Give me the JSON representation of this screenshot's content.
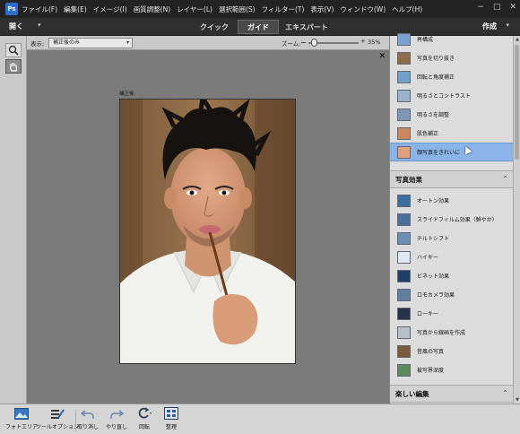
{
  "menubar": {
    "items": [
      "ファイル(F)",
      "編集(E)",
      "イメージ(I)",
      "画質調整(N)",
      "レイヤー(L)",
      "選択範囲(S)",
      "フィルター(T)",
      "表示(V)",
      "ウィンドウ(W)",
      "ヘルプ(H)"
    ],
    "window_controls": [
      "−",
      "□",
      "✕"
    ]
  },
  "modebar": {
    "open_label": "開く",
    "tabs": [
      "クイック",
      "ガイド",
      "エキスパート"
    ],
    "active_tab": "ガイド",
    "create_label": "作成"
  },
  "options": {
    "view_label": "表示:",
    "view_value": "補正後のみ",
    "zoom_label": "ズーム:",
    "zoom_value": "35%",
    "zoom_fraction": 0.05
  },
  "canvas": {
    "caption": "補正後",
    "close": "✕"
  },
  "panel": {
    "top_items": [
      {
        "label": "再構成",
        "icon": "recompose-thumb"
      },
      {
        "label": "写真を切り抜き",
        "icon": "crop-thumb"
      },
      {
        "label": "回転と角度補正",
        "icon": "rotate-thumb"
      },
      {
        "label": "明るさとコントラスト",
        "icon": "brightness-contrast-thumb"
      },
      {
        "label": "明るさを調整",
        "icon": "levels-thumb"
      },
      {
        "label": "肌色補正",
        "icon": "skin-tone-thumb"
      },
      {
        "label": "顔写真をきれいに",
        "icon": "perfect-portrait-thumb"
      }
    ],
    "selected_item": "顔写真をきれいに",
    "section_effects": "写真効果",
    "effect_items": [
      {
        "label": "オートン効果",
        "icon": "orton-thumb"
      },
      {
        "label": "スライドフィルム効果（鮮やか）",
        "icon": "slide-film-thumb"
      },
      {
        "label": "チルトシフト",
        "icon": "tilt-shift-thumb"
      },
      {
        "label": "ハイキー",
        "icon": "high-key-thumb"
      },
      {
        "label": "ビネット効果",
        "icon": "vignette-thumb"
      },
      {
        "label": "ロモカメラ効果",
        "icon": "lomo-thumb"
      },
      {
        "label": "ローキー",
        "icon": "low-key-thumb"
      },
      {
        "label": "写真から線画を作成",
        "icon": "line-drawing-thumb"
      },
      {
        "label": "昔風の写真",
        "icon": "old-fashioned-thumb"
      },
      {
        "label": "被写界深度",
        "icon": "depth-of-field-thumb"
      }
    ],
    "section_fun": "楽しい編集"
  },
  "bottombar": {
    "items": [
      {
        "label": "フォトエリア",
        "icon": "photo-bin-icon"
      },
      {
        "label": "ツールオプション",
        "icon": "tool-options-icon"
      },
      {
        "label": "取り消し",
        "icon": "undo-icon"
      },
      {
        "label": "やり直し",
        "icon": "redo-icon"
      },
      {
        "label": "回転",
        "icon": "rotate-icon"
      },
      {
        "label": "整理",
        "icon": "organize-icon"
      }
    ]
  },
  "colors": {
    "menubar_bg": "#232323",
    "panel_bg": "#dcdcdc",
    "selected_bg": "#8ab4e8",
    "canvas_bg": "#7b7b7b"
  }
}
